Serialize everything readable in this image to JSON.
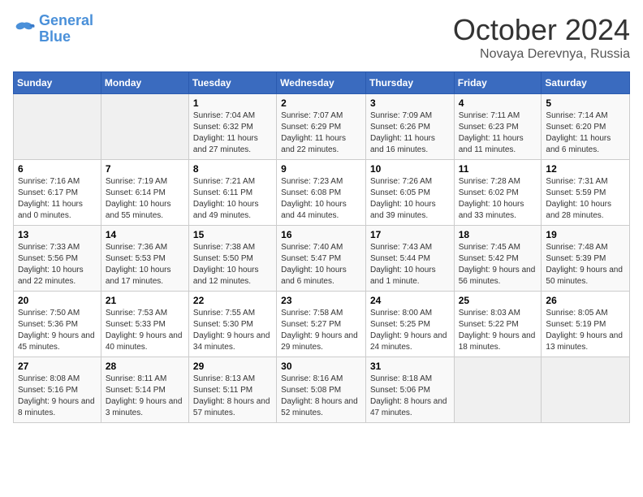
{
  "logo": {
    "line1": "General",
    "line2": "Blue"
  },
  "title": "October 2024",
  "location": "Novaya Derevnya, Russia",
  "days_of_week": [
    "Sunday",
    "Monday",
    "Tuesday",
    "Wednesday",
    "Thursday",
    "Friday",
    "Saturday"
  ],
  "weeks": [
    [
      {
        "day": "",
        "info": ""
      },
      {
        "day": "",
        "info": ""
      },
      {
        "day": "1",
        "info": "Sunrise: 7:04 AM\nSunset: 6:32 PM\nDaylight: 11 hours and 27 minutes."
      },
      {
        "day": "2",
        "info": "Sunrise: 7:07 AM\nSunset: 6:29 PM\nDaylight: 11 hours and 22 minutes."
      },
      {
        "day": "3",
        "info": "Sunrise: 7:09 AM\nSunset: 6:26 PM\nDaylight: 11 hours and 16 minutes."
      },
      {
        "day": "4",
        "info": "Sunrise: 7:11 AM\nSunset: 6:23 PM\nDaylight: 11 hours and 11 minutes."
      },
      {
        "day": "5",
        "info": "Sunrise: 7:14 AM\nSunset: 6:20 PM\nDaylight: 11 hours and 6 minutes."
      }
    ],
    [
      {
        "day": "6",
        "info": "Sunrise: 7:16 AM\nSunset: 6:17 PM\nDaylight: 11 hours and 0 minutes."
      },
      {
        "day": "7",
        "info": "Sunrise: 7:19 AM\nSunset: 6:14 PM\nDaylight: 10 hours and 55 minutes."
      },
      {
        "day": "8",
        "info": "Sunrise: 7:21 AM\nSunset: 6:11 PM\nDaylight: 10 hours and 49 minutes."
      },
      {
        "day": "9",
        "info": "Sunrise: 7:23 AM\nSunset: 6:08 PM\nDaylight: 10 hours and 44 minutes."
      },
      {
        "day": "10",
        "info": "Sunrise: 7:26 AM\nSunset: 6:05 PM\nDaylight: 10 hours and 39 minutes."
      },
      {
        "day": "11",
        "info": "Sunrise: 7:28 AM\nSunset: 6:02 PM\nDaylight: 10 hours and 33 minutes."
      },
      {
        "day": "12",
        "info": "Sunrise: 7:31 AM\nSunset: 5:59 PM\nDaylight: 10 hours and 28 minutes."
      }
    ],
    [
      {
        "day": "13",
        "info": "Sunrise: 7:33 AM\nSunset: 5:56 PM\nDaylight: 10 hours and 22 minutes."
      },
      {
        "day": "14",
        "info": "Sunrise: 7:36 AM\nSunset: 5:53 PM\nDaylight: 10 hours and 17 minutes."
      },
      {
        "day": "15",
        "info": "Sunrise: 7:38 AM\nSunset: 5:50 PM\nDaylight: 10 hours and 12 minutes."
      },
      {
        "day": "16",
        "info": "Sunrise: 7:40 AM\nSunset: 5:47 PM\nDaylight: 10 hours and 6 minutes."
      },
      {
        "day": "17",
        "info": "Sunrise: 7:43 AM\nSunset: 5:44 PM\nDaylight: 10 hours and 1 minute."
      },
      {
        "day": "18",
        "info": "Sunrise: 7:45 AM\nSunset: 5:42 PM\nDaylight: 9 hours and 56 minutes."
      },
      {
        "day": "19",
        "info": "Sunrise: 7:48 AM\nSunset: 5:39 PM\nDaylight: 9 hours and 50 minutes."
      }
    ],
    [
      {
        "day": "20",
        "info": "Sunrise: 7:50 AM\nSunset: 5:36 PM\nDaylight: 9 hours and 45 minutes."
      },
      {
        "day": "21",
        "info": "Sunrise: 7:53 AM\nSunset: 5:33 PM\nDaylight: 9 hours and 40 minutes."
      },
      {
        "day": "22",
        "info": "Sunrise: 7:55 AM\nSunset: 5:30 PM\nDaylight: 9 hours and 34 minutes."
      },
      {
        "day": "23",
        "info": "Sunrise: 7:58 AM\nSunset: 5:27 PM\nDaylight: 9 hours and 29 minutes."
      },
      {
        "day": "24",
        "info": "Sunrise: 8:00 AM\nSunset: 5:25 PM\nDaylight: 9 hours and 24 minutes."
      },
      {
        "day": "25",
        "info": "Sunrise: 8:03 AM\nSunset: 5:22 PM\nDaylight: 9 hours and 18 minutes."
      },
      {
        "day": "26",
        "info": "Sunrise: 8:05 AM\nSunset: 5:19 PM\nDaylight: 9 hours and 13 minutes."
      }
    ],
    [
      {
        "day": "27",
        "info": "Sunrise: 8:08 AM\nSunset: 5:16 PM\nDaylight: 9 hours and 8 minutes."
      },
      {
        "day": "28",
        "info": "Sunrise: 8:11 AM\nSunset: 5:14 PM\nDaylight: 9 hours and 3 minutes."
      },
      {
        "day": "29",
        "info": "Sunrise: 8:13 AM\nSunset: 5:11 PM\nDaylight: 8 hours and 57 minutes."
      },
      {
        "day": "30",
        "info": "Sunrise: 8:16 AM\nSunset: 5:08 PM\nDaylight: 8 hours and 52 minutes."
      },
      {
        "day": "31",
        "info": "Sunrise: 8:18 AM\nSunset: 5:06 PM\nDaylight: 8 hours and 47 minutes."
      },
      {
        "day": "",
        "info": ""
      },
      {
        "day": "",
        "info": ""
      }
    ]
  ]
}
